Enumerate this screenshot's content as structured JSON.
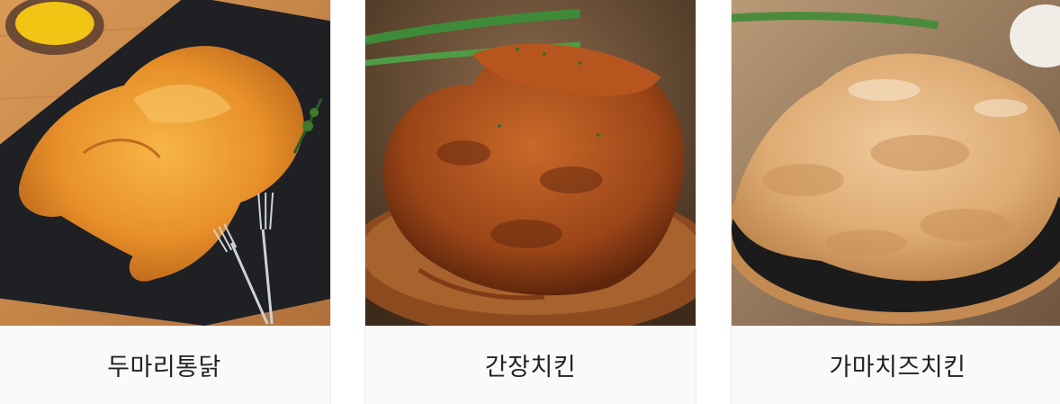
{
  "menu": {
    "items": [
      {
        "name": "두마리통닭",
        "photo": "whole-fried-chicken-photo"
      },
      {
        "name": "간장치킨",
        "photo": "soy-sauce-chicken-photo"
      },
      {
        "name": "가마치즈치킨",
        "photo": "cheese-powder-chicken-photo"
      }
    ]
  }
}
